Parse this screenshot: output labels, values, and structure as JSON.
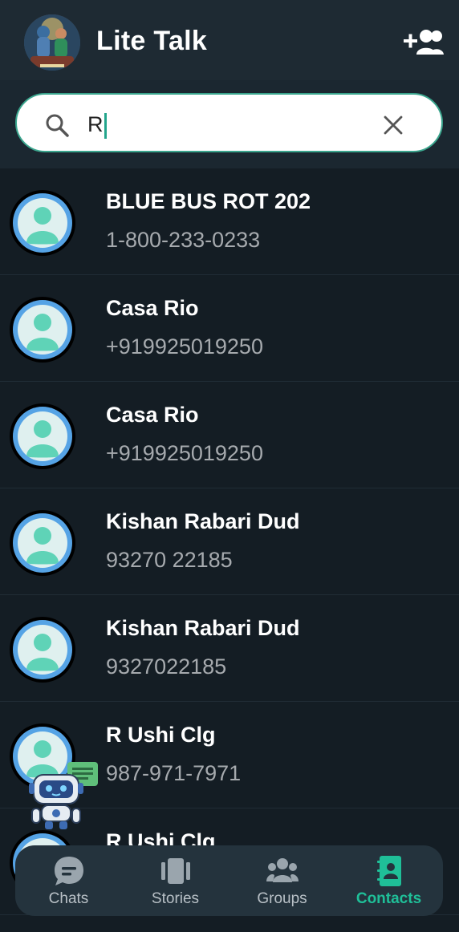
{
  "header": {
    "title": "Lite Talk",
    "avatar_icon": "profile-picture",
    "action_icon": "add-group-icon"
  },
  "search": {
    "value": "R",
    "search_icon": "search-icon",
    "clear_icon": "close-icon"
  },
  "contacts": [
    {
      "name": "BLUE BUS ROT 202",
      "phone": "1-800-233-0233"
    },
    {
      "name": "Casa Rio",
      "phone": "+919925019250"
    },
    {
      "name": "Casa Rio",
      "phone": "+919925019250"
    },
    {
      "name": "Kishan Rabari Dud",
      "phone": "93270 22185"
    },
    {
      "name": "Kishan Rabari Dud",
      "phone": "9327022185"
    },
    {
      "name": "R Ushi Clg",
      "phone": "987-971-7971"
    },
    {
      "name": "R Ushi Clg",
      "phone": ""
    }
  ],
  "nav": {
    "items": [
      {
        "label": "Chats",
        "icon": "chat-bubble-icon"
      },
      {
        "label": "Stories",
        "icon": "stories-icon"
      },
      {
        "label": "Groups",
        "icon": "groups-icon"
      },
      {
        "label": "Contacts",
        "icon": "contacts-book-icon"
      }
    ],
    "active": "Contacts"
  },
  "colors": {
    "background": "#141d24",
    "header": "#1e2a33",
    "accent": "#1fbf98",
    "avatar_ring": "#55a3e5",
    "avatar_person": "#5fd3b7"
  }
}
